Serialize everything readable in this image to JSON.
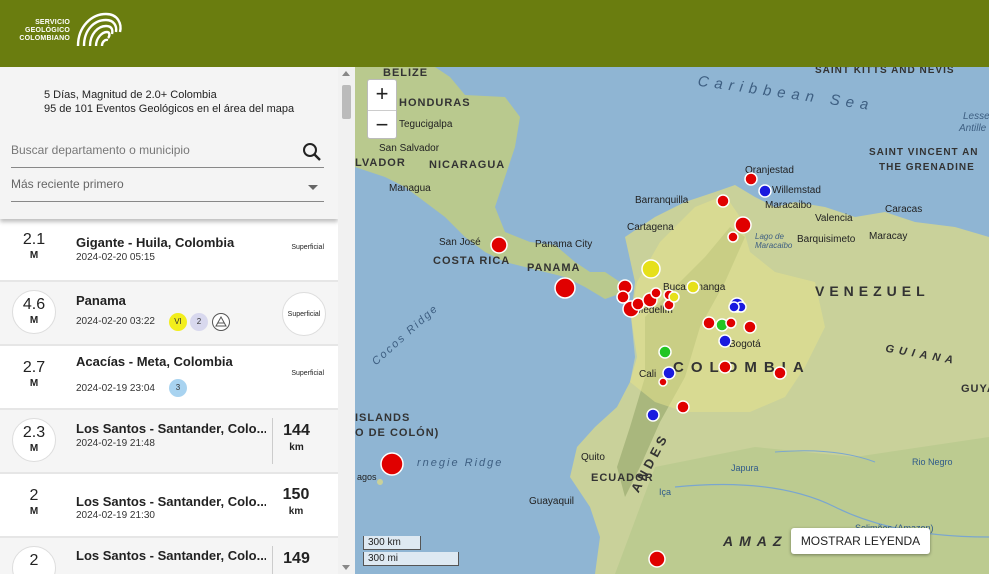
{
  "brand": {
    "line1": "SERVICIO",
    "line2": "GEOLÓGICO",
    "line3": "COLOMBIANO",
    "color": "#6a7d0f"
  },
  "summary": {
    "title": "5 Días, Magnitud de 2.0+ Colombia",
    "count": "95 de 101 Eventos Geológicos en el área del mapa"
  },
  "search": {
    "placeholder": "Buscar departamento o municipio"
  },
  "sort": {
    "value": "Más reciente primero"
  },
  "events": [
    {
      "mag": "2.1",
      "unit": "M",
      "place": "Gigante - Huila, Colombia",
      "datetime": "2024-02-20 05:15",
      "depth": "Superficial"
    },
    {
      "mag": "4.6",
      "unit": "M",
      "place": "Panama",
      "datetime": "2024-02-20 03:22",
      "badges": [
        "VI",
        "2"
      ],
      "depth": "Superficial"
    },
    {
      "mag": "2.7",
      "unit": "M",
      "place": "Acacías - Meta, Colombia",
      "datetime": "2024-02-19 23:04",
      "badges": [
        "3"
      ],
      "depth": "Superficial"
    },
    {
      "mag": "2.3",
      "unit": "M",
      "place": "Los Santos - Santander, Colo...",
      "datetime": "2024-02-19 21:48",
      "depth_val": "144",
      "depth_unit": "km"
    },
    {
      "mag": "2",
      "unit": "M",
      "place": "Los Santos - Santander, Colo...",
      "datetime": "2024-02-19 21:30",
      "depth_val": "150",
      "depth_unit": "km"
    },
    {
      "mag": "2",
      "unit": "M",
      "place": "Los Santos - Santander, Colo...",
      "datetime": "",
      "depth_val": "149",
      "depth_unit": ""
    }
  ],
  "map": {
    "labels": {
      "belize": "BELIZE",
      "honduras": "HONDURAS",
      "tegucigalpa": "Tegucigalpa",
      "salvador": "LVADOR",
      "san_salvador": "San Salvador",
      "nicaragua": "NICARAGUA",
      "managua": "Managua",
      "san_jose": "San José",
      "costa_rica": "COSTA RICA",
      "panama_city": "Panama City",
      "panama": "PANAMA",
      "caribbean": "Caribbean Sea",
      "saint_kitts": "SAINT KITTS AND NEVIS",
      "saint_vincent": "SAINT VINCENT AN",
      "grenadines": "THE GRENADINE",
      "lesser": "Lesse",
      "antilles": "Antille",
      "oranjestad": "Oranjestad",
      "willemstad": "Willemstad",
      "barranquilla": "Barranquilla",
      "cartagena": "Cartagena",
      "maracaibo": "Maracaibo",
      "valencia": "Valencia",
      "caracas": "Caracas",
      "barquisimeto": "Barquisimeto",
      "maracay": "Maracay",
      "lago": "Lago de Maracaibo",
      "venezuela": "VENEZUEL",
      "bucaramanga": "Bucaramanga",
      "medellin": "Medellín",
      "bogota": "Bogotá",
      "colombia": "COLOMBIA",
      "cali": "Cali",
      "guiana": "GUIANA",
      "guyana": "GUYA",
      "cocos": "Cocos Ridge",
      "islands": "ISLANDS",
      "colon": "O DE COLÓN)",
      "carnegie": "rnegie Ridge",
      "lagos": "agos",
      "quito": "Quito",
      "ecuador": "ECUADOR",
      "guayaquil": "Guayaquil",
      "japura": "Japura",
      "iça": "Iça",
      "negro": "Rio Negro",
      "amazonas": "Solimões (Amazon)",
      "andes": "ANDES",
      "amazonia": "AMAZ"
    },
    "scale_km": "300 km",
    "scale_mi": "300 mi",
    "zoom_in": "+",
    "zoom_out": "−",
    "legend_button": "MOSTRAR LEYENDA",
    "quake_colors": {
      "shallow": "#e00000",
      "medium": "#e6e01a",
      "intermediate": "#22c522",
      "deep": "#1a1adf"
    }
  }
}
